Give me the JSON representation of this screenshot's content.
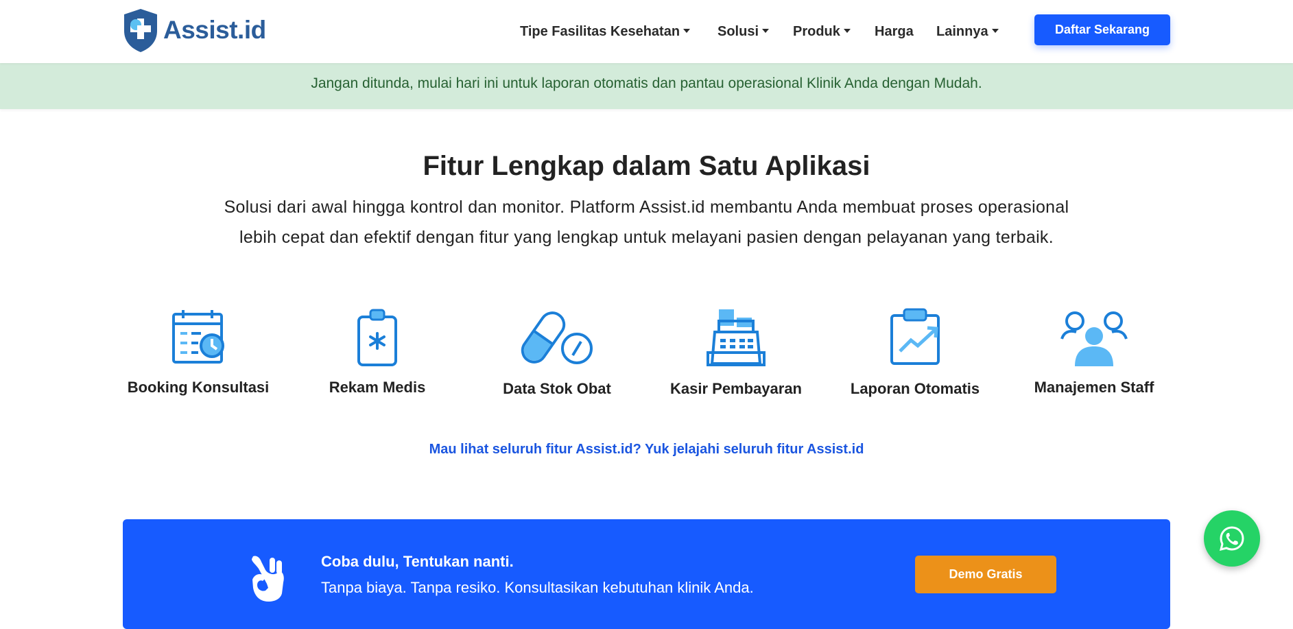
{
  "brand": {
    "name": "Assist.id",
    "logo_icon": "shield-cross-icon"
  },
  "nav": {
    "items": [
      {
        "label": "Tipe Fasilitas Kesehatan",
        "dropdown": true
      },
      {
        "label": "Solusi",
        "dropdown": true
      },
      {
        "label": "Produk",
        "dropdown": true
      },
      {
        "label": "Harga",
        "dropdown": false
      },
      {
        "label": "Lainnya",
        "dropdown": true
      }
    ],
    "cta_label": "Daftar Sekarang"
  },
  "banner": {
    "text": "Jangan ditunda, mulai hari ini untuk laporan otomatis dan pantau operasional Klinik Anda dengan Mudah."
  },
  "features": {
    "title": "Fitur Lengkap dalam Satu Aplikasi",
    "description": "Solusi dari awal hingga kontrol dan monitor. Platform Assist.id membantu Anda membuat proses operasional lebih cepat dan efektif dengan fitur yang lengkap untuk melayani pasien dengan pelayanan yang terbaik.",
    "items": [
      {
        "label": "Booking Konsultasi",
        "icon": "calendar-clock-icon"
      },
      {
        "label": "Rekam Medis",
        "icon": "medical-clipboard-icon"
      },
      {
        "label": "Data Stok Obat",
        "icon": "pill-capsule-icon"
      },
      {
        "label": "Kasir Pembayaran",
        "icon": "cash-register-icon"
      },
      {
        "label": "Laporan Otomatis",
        "icon": "report-chart-icon"
      },
      {
        "label": "Manajemen Staff",
        "icon": "staff-group-icon"
      }
    ],
    "link_text": "Mau lihat seluruh fitur Assist.id? Yuk jelajahi seluruh fitur Assist.id"
  },
  "cta": {
    "icon": "ok-hand-icon",
    "title": "Coba dulu, Tentukan nanti.",
    "subtitle": "Tanpa biaya. Tanpa resiko. Konsultasikan kebutuhan klinik Anda.",
    "button_label": "Demo Gratis"
  },
  "floating": {
    "icon": "whatsapp-icon"
  },
  "colors": {
    "primary": "#175bff",
    "icon_dark": "#1b7fd8",
    "icon_light": "#5bb8f5",
    "banner_bg": "#d3ebda",
    "banner_text": "#276132",
    "demo_button": "#ec9119",
    "whatsapp": "#25d366"
  }
}
